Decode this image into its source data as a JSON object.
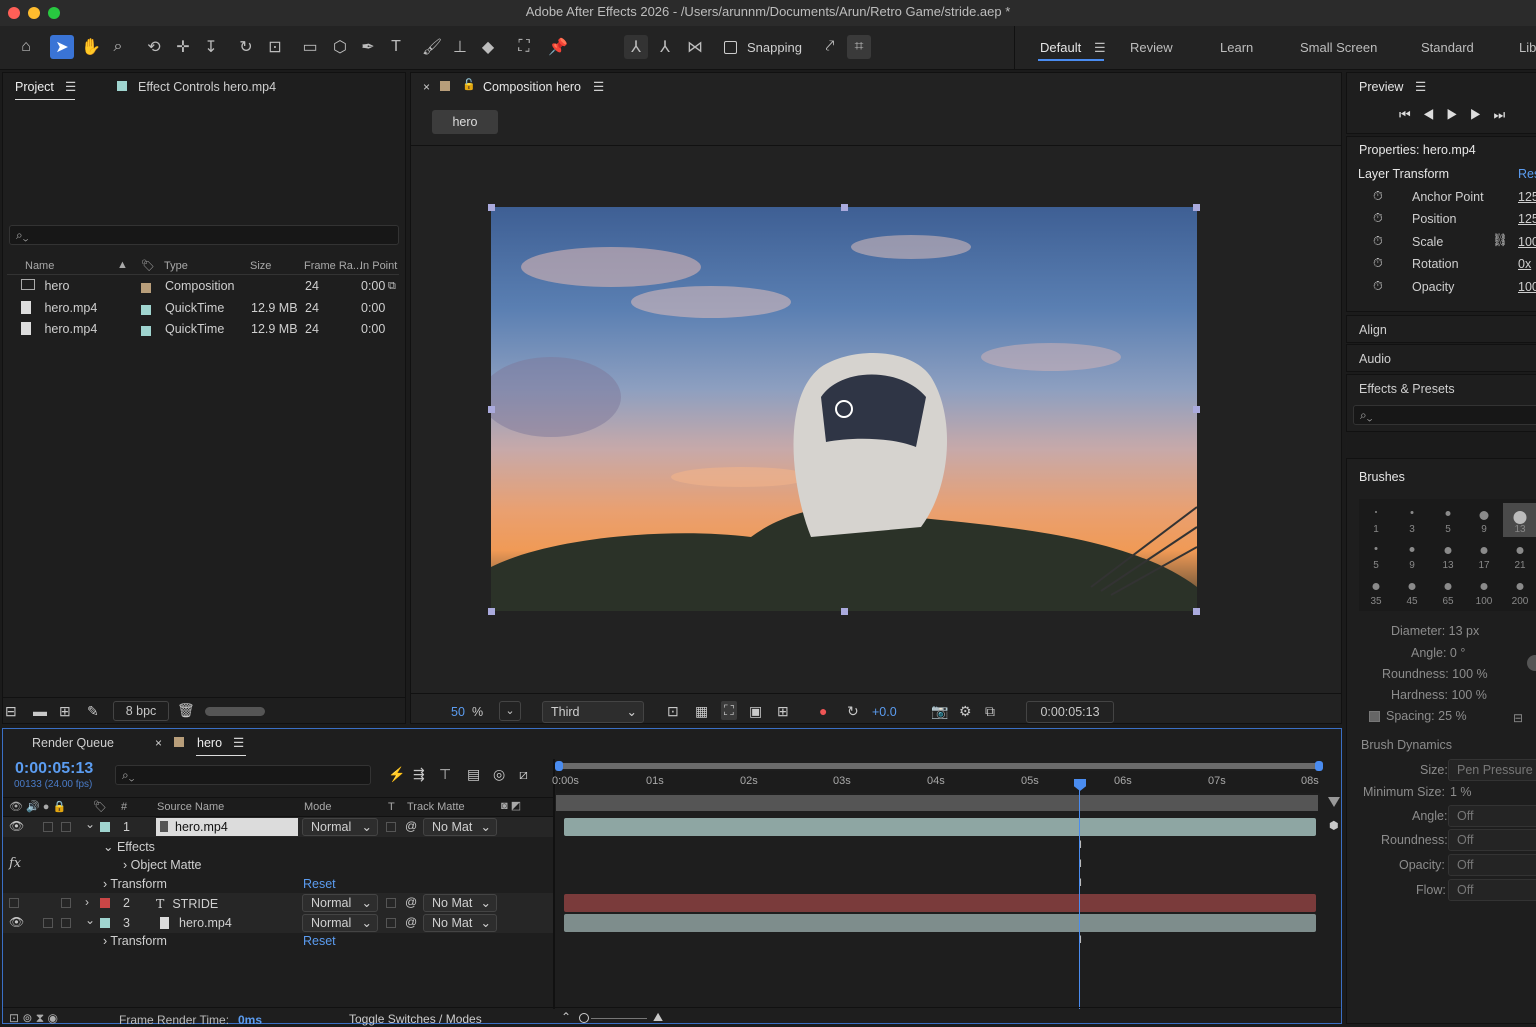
{
  "app": {
    "title": "Adobe After Effects 2026 - /Users/arunnm/Documents/Arun/Retro Game/stride.aep *"
  },
  "toolbar": {
    "snapping": "Snapping",
    "workspaces": [
      "Default",
      "Review",
      "Learn",
      "Small Screen",
      "Standard",
      "Lib"
    ]
  },
  "project_panel": {
    "tab_project": "Project",
    "tab_effect_controls": "Effect Controls hero.mp4",
    "columns": {
      "name": "Name",
      "type": "Type",
      "size": "Size",
      "frame_rate": "Frame Ra...",
      "in_point": "In Point"
    },
    "rows": [
      {
        "name": "hero",
        "type": "Composition",
        "size": "",
        "fps": "24",
        "in": "0:00"
      },
      {
        "name": "hero.mp4",
        "type": "QuickTime",
        "size": "12.9 MB",
        "fps": "24",
        "in": "0:00"
      },
      {
        "name": "hero.mp4",
        "type": "QuickTime",
        "size": "12.9 MB",
        "fps": "24",
        "in": "0:00"
      }
    ],
    "bpc": "8 bpc"
  },
  "composition": {
    "tab": "Composition hero",
    "chip": "hero",
    "zoom": "50",
    "zoom_unit": "%",
    "resolution": "Third",
    "exposure": "+0.0",
    "timecode": "0:00:05:13"
  },
  "preview": {
    "title": "Preview"
  },
  "properties": {
    "title": "Properties: hero.mp4",
    "section": "Layer Transform",
    "reset": "Res",
    "items": [
      {
        "label": "Anchor Point",
        "value": "125"
      },
      {
        "label": "Position",
        "value": "125"
      },
      {
        "label": "Scale",
        "value": "100"
      },
      {
        "label": "Rotation",
        "value": "0x"
      },
      {
        "label": "Opacity",
        "value": "100"
      }
    ]
  },
  "side_sections": {
    "align": "Align",
    "audio": "Audio",
    "effects_presets": "Effects & Presets",
    "brushes": "Brushes"
  },
  "brushes": {
    "sizes": [
      "1",
      "3",
      "5",
      "9",
      "13",
      "5",
      "9",
      "13",
      "17",
      "21",
      "35",
      "45",
      "65",
      "100",
      "200"
    ],
    "diameter": "Diameter: 13 px",
    "angle": "Angle: 0 °",
    "roundness": "Roundness: 100 %",
    "hardness": "Hardness: 100 %",
    "spacing": "Spacing: 25 %",
    "dynamics_title": "Brush Dynamics",
    "dynamics": [
      {
        "label": "Size:",
        "value": "Pen Pressure"
      },
      {
        "label": "Minimum Size:",
        "value": "1 %"
      },
      {
        "label": "Angle:",
        "value": "Off"
      },
      {
        "label": "Roundness:",
        "value": "Off"
      },
      {
        "label": "Opacity:",
        "value": "Off"
      },
      {
        "label": "Flow:",
        "value": "Off"
      }
    ]
  },
  "timeline": {
    "tab_render": "Render Queue",
    "tab_comp": "hero",
    "timecode": "0:00:05:13",
    "frames": "00133 (24.00 fps)",
    "columns": {
      "num": "#",
      "source": "Source Name",
      "mode": "Mode",
      "t": "T",
      "track": "Track Matte"
    },
    "ruler": [
      "0:00s",
      "01s",
      "02s",
      "03s",
      "04s",
      "05s",
      "06s",
      "07s",
      "08s"
    ],
    "layers": [
      {
        "num": "1",
        "name": "hero.mp4",
        "mode": "Normal",
        "matte": "No Mat"
      },
      {
        "num": "2",
        "name": "STRIDE",
        "mode": "Normal",
        "matte": "No Mat"
      },
      {
        "num": "3",
        "name": "hero.mp4",
        "mode": "Normal",
        "matte": "No Mat"
      }
    ],
    "effects": "Effects",
    "object_matte": "Object Matte",
    "transform": "Transform",
    "reset": "Reset",
    "frame_render_label": "Frame Render Time:",
    "frame_render_value": "0ms",
    "toggle": "Toggle Switches / Modes"
  },
  "colors": {
    "accent": "#3a74d6",
    "stride_bar": "#7a3b3b",
    "hero_bar": "#8ea6a3"
  }
}
